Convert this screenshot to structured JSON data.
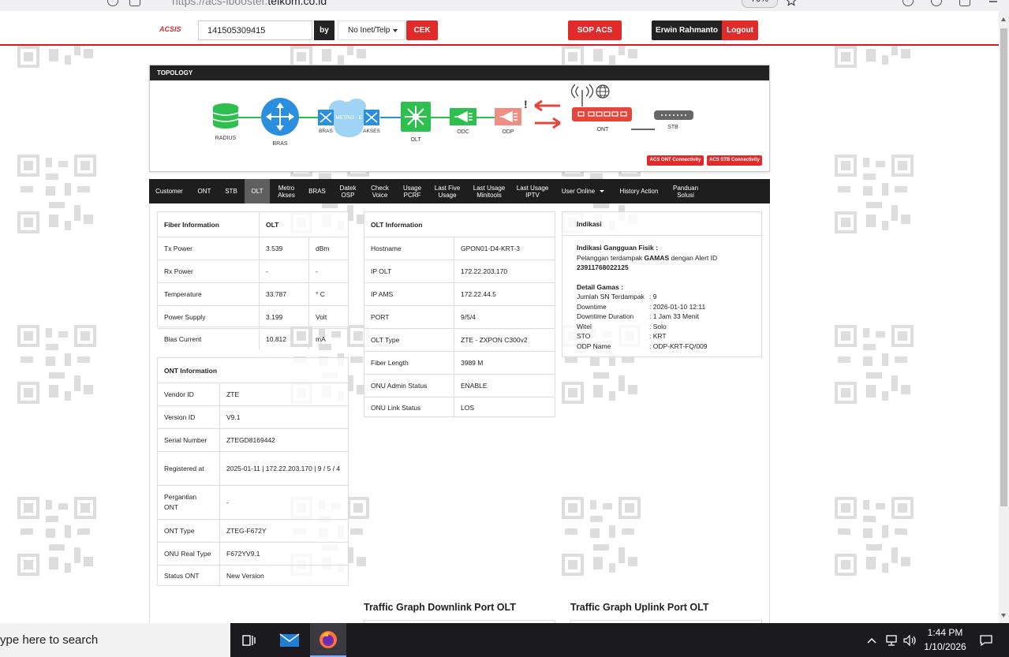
{
  "browser": {
    "url_prefix": "https://acs-ibooster.",
    "url_domain": "telkom.co.id",
    "zoom": "70%"
  },
  "header": {
    "logo": "ACSIS",
    "search_value": "141505309415",
    "by_label": "by",
    "filter_value": "No Inet/Telp",
    "check_button": "CEK",
    "sop_button": "SOP ACS",
    "user_name": "Erwin Rahmanto",
    "logout_button": "Logout"
  },
  "topology": {
    "title": "TOPOLOGY",
    "nodes": {
      "radius": "RADIUS",
      "bras": "BRAS",
      "bras2": "BRAS",
      "metro": "METRO - E",
      "akses": "AKSES",
      "olt": "OLT",
      "odc": "ODC",
      "odp": "ODP",
      "ont": "ONT",
      "stb": "STB"
    },
    "alert_mark": "!",
    "ont_connectivity_button": "ACS ONT Connectivity",
    "stb_connectivity_button": "ACS STB Connectivity",
    "colors": {
      "green": "#2ec04f",
      "blue": "#2a8fde",
      "red": "#e5463b",
      "pink": "#f08d84",
      "cloud": "#9fd4f5",
      "gray": "#666666"
    }
  },
  "tabs": [
    {
      "label": "Customer"
    },
    {
      "label": "ONT"
    },
    {
      "label": "STB"
    },
    {
      "label": "OLT"
    },
    {
      "label": "Metro\nAkses"
    },
    {
      "label": "BRAS"
    },
    {
      "label": "Datek\nOSP"
    },
    {
      "label": "Check\nVoice"
    },
    {
      "label": "Usage\nPCRF"
    },
    {
      "label": "Last Five\nUsage"
    },
    {
      "label": "Last Usage\nMinitools"
    },
    {
      "label": "Last Usage\nIPTV"
    },
    {
      "label": "User Online"
    },
    {
      "label": "History Action"
    },
    {
      "label": "Panduan\nSolusi"
    }
  ],
  "active_tab": "OLT",
  "fiber": {
    "header": [
      "Fiber Information",
      "OLT",
      ""
    ],
    "rows": [
      [
        "Tx Power",
        "3.539",
        "dBm"
      ],
      [
        "Rx Power",
        "-",
        "-"
      ],
      [
        "Temperature",
        "33.787",
        "° C"
      ],
      [
        "Power Supply",
        "3.199",
        "Volt"
      ],
      [
        "Bias Current",
        "10.812",
        "mA"
      ]
    ]
  },
  "ont_info": {
    "header": "ONT Information",
    "rows": [
      [
        "Vendor ID",
        "ZTE"
      ],
      [
        "Version ID",
        "V9.1"
      ],
      [
        "Serial Number",
        "ZTEGD8169442"
      ],
      [
        "Registered at",
        "2025-01-11 | 172.22.203.170 | 9 / 5 / 4"
      ],
      [
        "Pergantian ONT",
        "-"
      ],
      [
        "ONT Type",
        "ZTEG-F672Y"
      ],
      [
        "ONU Real Type",
        "F672YV9.1"
      ],
      [
        "Status ONT",
        "New Version"
      ]
    ]
  },
  "olt_info": {
    "header": "OLT Information",
    "rows": [
      [
        "Hostname",
        "GPON01-D4-KRT-3"
      ],
      [
        "IP OLT",
        "172.22.203.170"
      ],
      [
        "IP AMS",
        "172.22.44.5"
      ],
      [
        "PORT",
        "9/5/4"
      ],
      [
        "OLT Type",
        "ZTE - ZXPON C300v2"
      ],
      [
        "Fiber Length",
        "3989 M"
      ],
      [
        "ONU Admin Status",
        "ENABLE"
      ],
      [
        "ONU Link Status",
        "LOS"
      ]
    ]
  },
  "indikasi": {
    "header": "Indikasi",
    "title": "Indikasi Gangguan Fisik :",
    "line1_prefix": "Pelanggan terdampak ",
    "line1_bold": "GAMAS",
    "line1_suffix": " dengan Alert ID",
    "alert_id": "23911768022125",
    "detail_title": "Detail Gamas :",
    "details": [
      [
        "Jumlah SN Terdampak",
        ": 9"
      ],
      [
        "Downtime",
        ": 2026-01-10 12:11"
      ],
      [
        "Downtime Duration",
        ": 1 Jam 33 Menit"
      ],
      [
        "Witel",
        ": Solo"
      ],
      [
        "STO",
        ": KRT"
      ],
      [
        "ODP Name",
        ": ODP-KRT-FQ/009"
      ]
    ]
  },
  "traffic": {
    "downlink": "Traffic Graph Downlink Port OLT",
    "uplink": "Traffic Graph Uplink Port OLT"
  },
  "taskbar": {
    "search_placeholder": "ype here to search",
    "time": "1:44 PM",
    "date": "1/10/2026"
  }
}
